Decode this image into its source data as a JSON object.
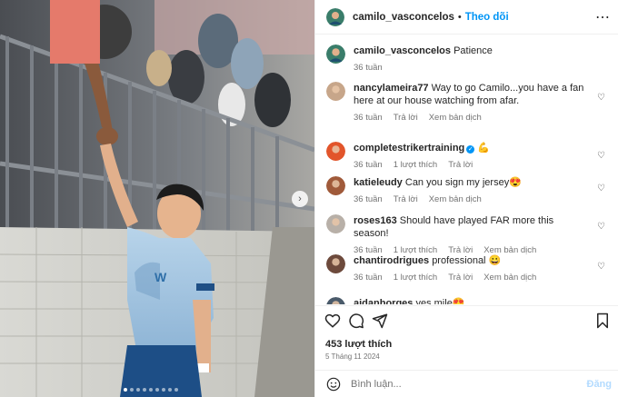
{
  "post": {
    "author": "camilo_vasconcelos",
    "separator": "•",
    "follow_label": "Theo dõi",
    "more_label": "⋯",
    "caption": {
      "user": "camilo_vasconcelos",
      "text": "Patience",
      "time": "36 tuần"
    }
  },
  "comments": [
    {
      "user": "nancylameira77",
      "text": "Way to go Camilo...you have a fan here at our house watching from afar.",
      "time": "36 tuần",
      "likes": "",
      "reply": "Trả lời",
      "translate": "Xem bản dịch",
      "avatar_color": "#c7a68a"
    },
    {
      "user": "completestrikertraining",
      "verified": true,
      "text": "💪",
      "time": "36 tuần",
      "likes": "1 lượt thích",
      "reply": "Trả lời",
      "translate": "",
      "avatar_color": "#e2552b"
    },
    {
      "user": "katieleudy",
      "text": "Can you sign my jersey😍",
      "time": "36 tuần",
      "likes": "",
      "reply": "Trả lời",
      "translate": "Xem bản dịch",
      "avatar_color": "#a05a3a"
    },
    {
      "user": "roses163",
      "text": "Should have played FAR more this season!",
      "time": "36 tuần",
      "likes": "1 lượt thích",
      "reply": "Trả lời",
      "translate": "Xem bản dịch",
      "avatar_color": "#b8b0a8"
    },
    {
      "user": "chantirodrigues",
      "text": "professional 😀",
      "time": "36 tuần",
      "likes": "1 lượt thích",
      "reply": "Trả lời",
      "translate": "Xem bản dịch",
      "avatar_color": "#6d4a3c"
    },
    {
      "user": "aidanborges",
      "text": "yes mile😍",
      "time": "",
      "likes": "",
      "reply": "",
      "translate": "",
      "avatar_color": "#4a5a6a"
    }
  ],
  "engagement": {
    "likes": "453 lượt thích",
    "date": "5 Tháng 11 2024"
  },
  "comment_box": {
    "placeholder": "Bình luận...",
    "post_label": "Đăng"
  },
  "icons": {
    "like": "heart-icon",
    "comment": "comment-icon",
    "share": "share-icon",
    "save": "bookmark-icon",
    "emoji": "smiley-icon",
    "next": "chevron-right-icon"
  },
  "carousel": {
    "slides": 9,
    "active_index": 0
  },
  "colors": {
    "accent": "#0095f6",
    "muted": "#737373",
    "border": "#efefef"
  }
}
